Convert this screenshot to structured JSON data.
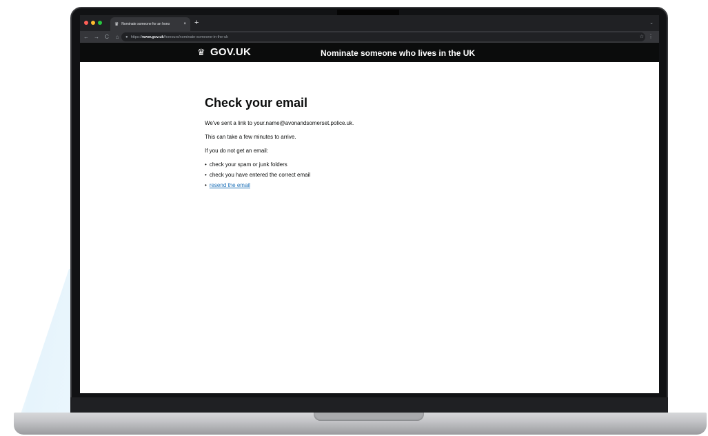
{
  "browser": {
    "tab_title": "Nominate someone for an hono",
    "new_tab_glyph": "+",
    "tab_close_glyph": "×",
    "address_protocol": "https://",
    "address_host": "www.gov.uk",
    "address_path": "/honours/nominate-someone-in-the-uk",
    "icons": {
      "back": "←",
      "forward": "→",
      "reload": "C",
      "home": "⌂",
      "lock": "🔒",
      "bookmark": "☆",
      "menu": "⋮",
      "tab_dropdown": "⌄"
    },
    "traffic_lights": [
      "#ff5f57",
      "#febc2e",
      "#28c840"
    ]
  },
  "header": {
    "logo_text": "GOV.UK",
    "crown_icon": "♛",
    "service_name": "Nominate someone who lives in the UK",
    "background": "#0b0c0c"
  },
  "main": {
    "heading": "Check your email",
    "sent_message": "We've sent a link to your.name@avonandsomerset.police.uk.",
    "wait_message": "This can take a few minutes to arrive.",
    "no_email_intro": "If you do not get an email:",
    "tips": [
      "check your spam or junk folders",
      "check you have entered the correct email"
    ],
    "resend_link": "resend the email",
    "link_color": "#1d70b8"
  }
}
